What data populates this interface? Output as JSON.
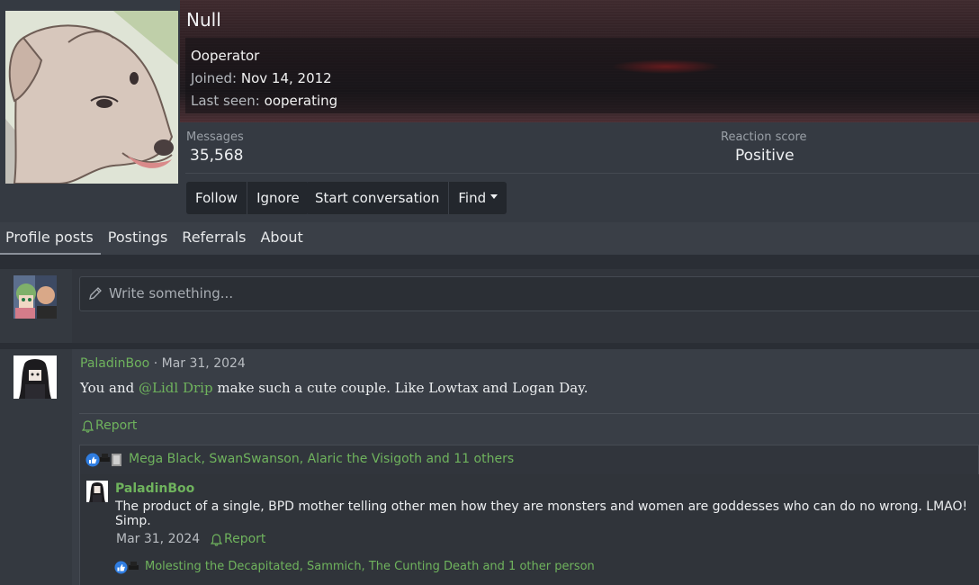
{
  "profile": {
    "username": "Null",
    "title": "Ooperator",
    "joined_label": "Joined:",
    "joined_value": "Nov 14, 2012",
    "last_seen_label": "Last seen:",
    "last_seen_value": "ooperating"
  },
  "stats": {
    "messages_label": "Messages",
    "messages_value": "35,568",
    "reaction_label": "Reaction score",
    "reaction_value": "Positive"
  },
  "actions": {
    "follow": "Follow",
    "ignore": "Ignore",
    "start_conversation": "Start conversation",
    "find": "Find"
  },
  "tabs": [
    {
      "label": "Profile posts",
      "active": true
    },
    {
      "label": "Postings"
    },
    {
      "label": "Referrals"
    },
    {
      "label": "About"
    }
  ],
  "composer": {
    "placeholder": "Write something..."
  },
  "post": {
    "author": "PaladinBoo",
    "separator": "·",
    "date": "Mar 31, 2024",
    "body_before": "You and ",
    "mention": "@Lidl Drip",
    "body_after": " make such a cute couple. Like Lowtax and Logan Day.",
    "report": "Report",
    "reactions": "Mega Black, SwanSwanson, Alaric the Visigoth and 11 others"
  },
  "reply": {
    "author": "PaladinBoo",
    "body": "The product of a single, BPD mother telling other men how they are monsters and women are goddesses who can do no wrong. LMAO! Simp.",
    "date": "Mar 31, 2024",
    "report": "Report",
    "reactions": "Molesting the Decapitated, Sammich, The Cunting Death and 1 other person"
  },
  "colors": {
    "link": "#6fb35d",
    "background": "#2c3038",
    "panel": "#393e46",
    "button": "#23272d"
  }
}
